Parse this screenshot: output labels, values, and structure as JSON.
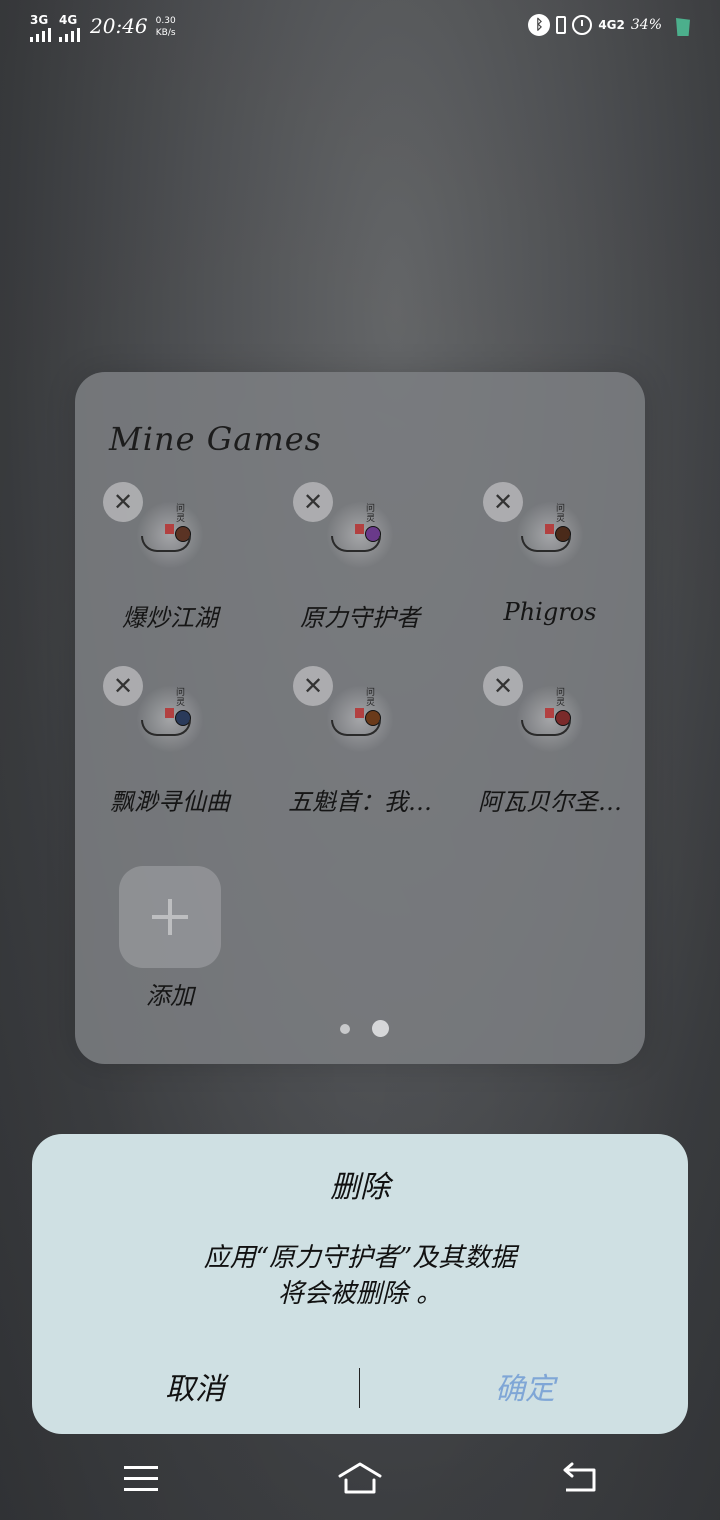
{
  "status_bar": {
    "net1": "3G",
    "net2": "4G",
    "time": "20:46",
    "speed_value": "0.30",
    "speed_unit": "KB/s",
    "net3": "4G2",
    "battery": "34%"
  },
  "folder": {
    "title": "Mine Games",
    "apps": [
      {
        "name": "爆炒江湖"
      },
      {
        "name": "原力守护者"
      },
      {
        "name": "Phigros"
      },
      {
        "name": "飘渺寻仙曲"
      },
      {
        "name": "五魁首：我…"
      },
      {
        "name": "阿瓦贝尔圣…"
      }
    ],
    "add_label": "添加",
    "close_glyph": "✕",
    "icon_mark": "问灵",
    "page_count": 2,
    "active_page": 2
  },
  "dialog": {
    "title": "删除",
    "message_line1": "应用“原力守护者”及其数据",
    "message_line2": "将会被删除 。",
    "cancel": "取消",
    "confirm": "确定",
    "confirm_color": "#7fa6d6"
  },
  "icons": {
    "close": "close-icon",
    "add": "plus-icon",
    "nav_menu": "menu-icon",
    "nav_home": "home-icon",
    "nav_back": "back-icon"
  }
}
